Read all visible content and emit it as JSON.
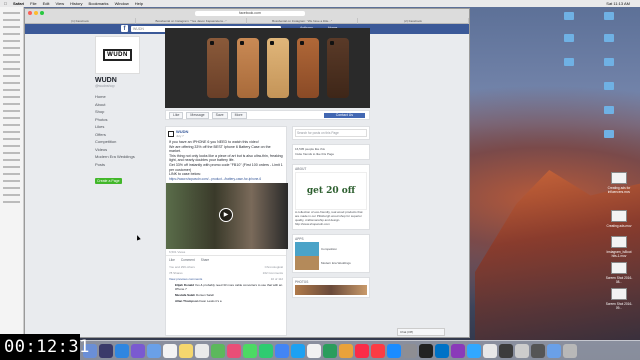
{
  "menubar": {
    "app": "Safari",
    "items": [
      "File",
      "Edit",
      "View",
      "History",
      "Bookmarks",
      "Window",
      "Help"
    ],
    "clock": "Sat 11:13 AM"
  },
  "browser": {
    "url": "facebook.com",
    "tabs": [
      "(1) Facebook",
      "Bossbenial on Instagram: \"Yes Jason Kapaszelens...\"",
      "Bossbenial on Instagram: \"We have a little...\"",
      "(2) Facebook"
    ]
  },
  "fb": {
    "logo": "f",
    "search_placeholder": "WUDN",
    "user": "Anthony",
    "home": "Home"
  },
  "page": {
    "logo_text": "WUDN",
    "name": "WUDN",
    "handle": "@wudnshop",
    "nav": [
      "Home",
      "About",
      "Shop",
      "Photos",
      "Likes",
      "Offers",
      "Competition",
      "Videos",
      "Modern Era Weddings",
      "Posts"
    ],
    "create_page": "Create a Page",
    "actions": [
      "Like",
      "Message",
      "Save",
      "More"
    ],
    "contact": "Contact Us"
  },
  "post": {
    "author": "WUDN",
    "time": "July 7",
    "lines": [
      "If you have an IPHONE 6 you NEED to watch this video!",
      "We are offering 33% off the BEST Iphone 6 Battery Case on the market.",
      "This thing not only looks like a piece of art but is also ultra-thin, freaking light, and nearly doubles your battery life.",
      "Get 33% off instantly with promo code \"FB10\" (First 100 orders - Limit 1 per customer)",
      "LINK to case below:"
    ],
    "link": "https://www.shopwudn.com/...product.../battery-case-for-iphone-6",
    "views": "6,501 Views",
    "reactions": [
      "Like",
      "Comment",
      "Share"
    ],
    "likes": "You and 299 others",
    "order": "Chronological",
    "shares": "78 Shares",
    "comments_count": "162 Comments",
    "view_prev": "View previous comments",
    "view_prev_count": "10 of 112",
    "comments": [
      {
        "name": "Elijah Donald",
        "text": "Yes & probably need 33 more cable converters to use that with an iPhone 7"
      },
      {
        "name": "Mustafa Saleh",
        "text": "Dorsen Saleh"
      },
      {
        "name": "Allan Thompson",
        "text": "Faon Lewis it's a"
      }
    ]
  },
  "right": {
    "search": "Search for posts on this Page",
    "likes": "16,505 people like this",
    "invite": "Invite friends to like this Page",
    "about_head": "ABOUT",
    "about_text": "A collection of eco-friendly, real wood products that are made in our Pittsburgh wood shop for superior quality, craftsmanship and design.",
    "website": "http://www.shopwudn.com",
    "apps_head": "APPS",
    "apps": [
      "Competition",
      "Modern Era Weddings"
    ],
    "photos_head": "PHOTOS",
    "getoff": "get 20 off"
  },
  "chat": "Chat (Off)",
  "desktop": {
    "labels": [
      "Creating ads for influencers.mov",
      "Creating ads.mov",
      "Instagram_IsBoot hits-1.mov",
      "Screen Shot 2016-08...",
      "Screen Shot 2016-09..."
    ]
  },
  "timer": "00:12:31"
}
